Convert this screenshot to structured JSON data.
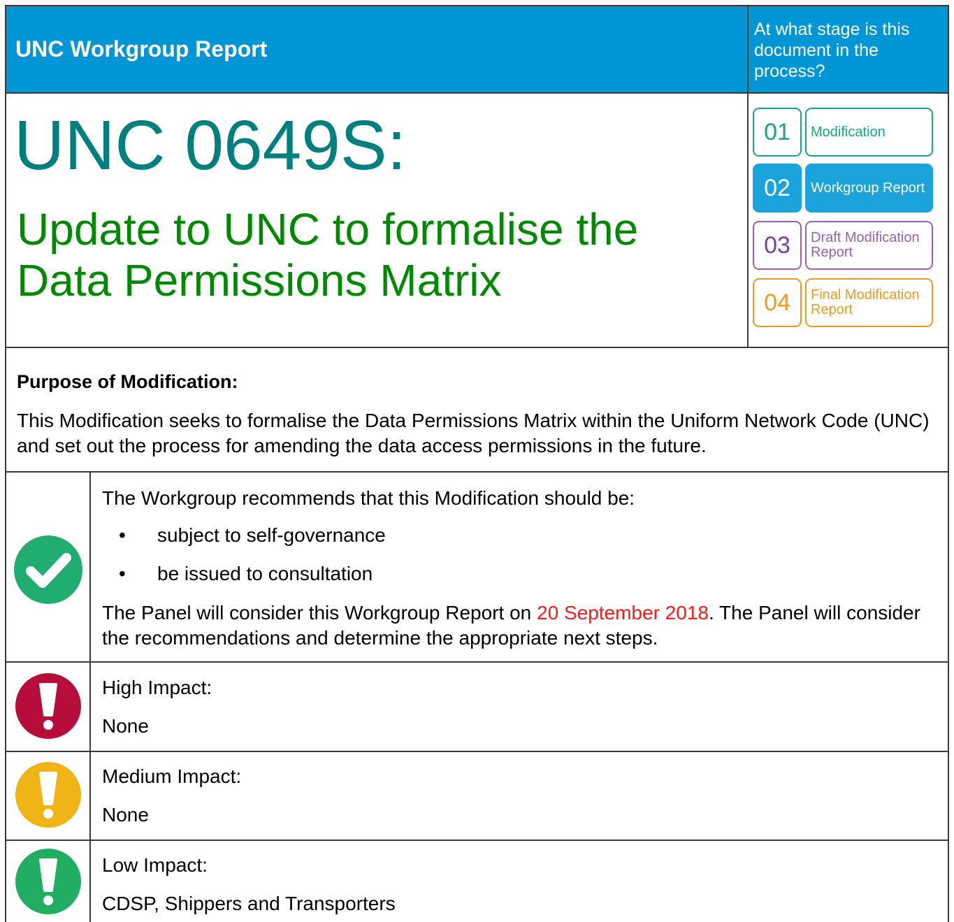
{
  "header": {
    "title": "UNC Workgroup Report",
    "stage_question": "At what stage is this document in the process?"
  },
  "modification": {
    "code": "UNC 0649S:",
    "title": "Update to UNC to formalise the Data Permissions Matrix"
  },
  "stages": [
    {
      "num": "01",
      "label": "Modification",
      "color": "#17a67f",
      "active": false
    },
    {
      "num": "02",
      "label": "Workgroup Report",
      "color": "#1ba3dc",
      "active": true
    },
    {
      "num": "03",
      "label": "Draft Modification Report",
      "color": "#9b5fb6",
      "active": false
    },
    {
      "num": "04",
      "label": "Final Modification Report",
      "color": "#f09a1c",
      "active": false
    }
  ],
  "purpose": {
    "heading": "Purpose of Modification:",
    "text": "This Modification seeks to formalise the Data Permissions Matrix within the Uniform Network Code (UNC) and set out the process for amending the data access permissions in the future."
  },
  "recommendation": {
    "intro": "The Workgroup recommends that this Modification should be:",
    "bullets": [
      "subject to self-governance",
      "be issued to consultation"
    ],
    "panel_prefix": "The Panel will consider this Workgroup Report on ",
    "panel_date": "20 September 2018",
    "panel_suffix": ".  The Panel will consider the recommendations and determine the appropriate next steps."
  },
  "impacts": [
    {
      "label": "High Impact:",
      "value": "None",
      "color": "#b60d3a",
      "icon": "exclamation-icon"
    },
    {
      "label": "Medium Impact:",
      "value": "None",
      "color": "#f0b416",
      "icon": "exclamation-icon"
    },
    {
      "label": "Low Impact:",
      "value": "CDSP, Shippers and Transporters",
      "color": "#21ad62",
      "icon": "exclamation-icon"
    }
  ],
  "check_color": "#21ad6f"
}
